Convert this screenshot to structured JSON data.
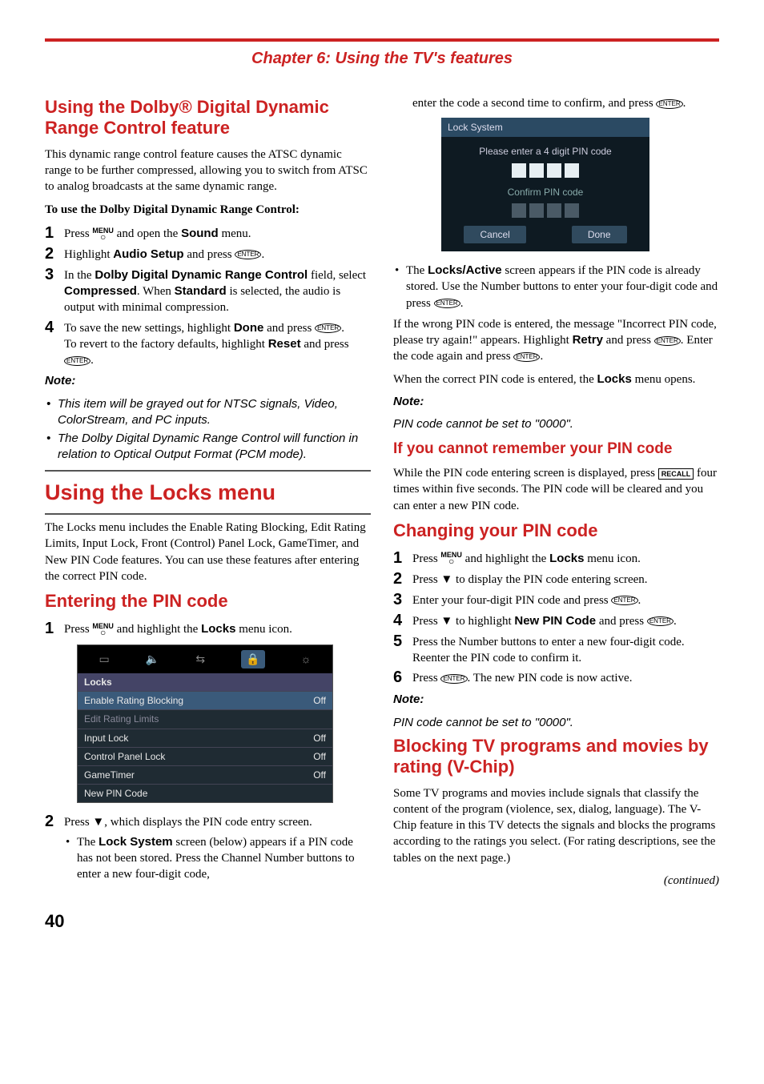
{
  "chapter": "Chapter 6: Using the TV's features",
  "left": {
    "h_dolby": "Using the Dolby® Digital Dynamic Range Control feature",
    "p_dolby_intro": "This dynamic range control feature causes the ATSC dynamic range to be further compressed, allowing you to switch from ATSC to analog broadcasts at the same dynamic range.",
    "p_dolby_use": "To use the Dolby Digital Dynamic Range Control:",
    "s1a": "Press ",
    "s1b": " and open the ",
    "s1c": "Sound",
    "s1d": " menu.",
    "s2a": "Highlight ",
    "s2b": "Audio Setup",
    "s2c": " and press ",
    "s3a": "In the ",
    "s3b": "Dolby Digital Dynamic Range Control",
    "s3c": " field, select ",
    "s3d": "Compressed",
    "s3e": ". When ",
    "s3f": "Standard",
    "s3g": " is selected, the audio is output with minimal compression.",
    "s4a": "To save the new settings, highlight ",
    "s4b": "Done",
    "s4c": " and press ",
    "s4d": "To revert to the factory defaults, highlight ",
    "s4e": "Reset",
    "s4f": " and press ",
    "note": "Note:",
    "note1": "This item will be grayed out for NTSC signals, Video, ColorStream, and PC inputs.",
    "note2": "The Dolby Digital Dynamic Range Control will function in relation to Optical Output Format (PCM mode).",
    "h_locks": "Using the Locks menu",
    "p_locks_intro": "The Locks menu includes the Enable Rating Blocking, Edit Rating Limits, Input Lock, Front (Control) Panel Lock, GameTimer, and New PIN Code features. You can use these features after entering the correct PIN code.",
    "h_enter_pin": "Entering the PIN code",
    "ep1a": "Press ",
    "ep1b": " and highlight the ",
    "ep1c": "Locks",
    "ep1d": " menu icon.",
    "locks_ui": {
      "title": "Locks",
      "rows": [
        {
          "label": "Enable Rating Blocking",
          "val": "Off"
        },
        {
          "label": "Edit Rating Limits",
          "val": ""
        },
        {
          "label": "Input Lock",
          "val": "Off"
        },
        {
          "label": "Control Panel Lock",
          "val": "Off"
        },
        {
          "label": "GameTimer",
          "val": "Off"
        },
        {
          "label": "New PIN Code",
          "val": ""
        }
      ]
    },
    "ep2a": "Press ",
    "ep2b": ", which displays the PIN code entry screen.",
    "ep2_b1a": "The ",
    "ep2_b1b": "Lock System",
    "ep2_b1c": " screen (below) appears if a PIN code has not been stored. Press the Channel Number buttons to enter a new four-digit code,"
  },
  "right": {
    "cont_top": "enter the code a second time to confirm, and press ",
    "locksys": {
      "title": "Lock System",
      "msg1": "Please enter a 4 digit PIN code",
      "msg2": "Confirm PIN code",
      "cancel": "Cancel",
      "done": "Done"
    },
    "b2a": "The ",
    "b2b": "Locks/Active",
    "b2c": " screen appears if the PIN code is already stored. Use the Number buttons to enter your four-digit code and press ",
    "wrong1": "If the wrong PIN code is entered, the message \"Incorrect PIN code, please try again!\" appears. Highlight ",
    "wrong2": "Retry",
    "wrong3": " and press ",
    "wrong4": ". Enter the code again and press ",
    "correct1": "When the correct PIN code is entered, the ",
    "correct2": "Locks",
    "correct3": " menu opens.",
    "note": "Note:",
    "note_pin": "PIN code cannot be set to \"0000\".",
    "h_forget": "If you cannot remember your PIN code",
    "p_forget1": "While the PIN code entering screen is displayed, press ",
    "p_forget2": " four times within five seconds. The PIN code will be cleared and you can enter a new PIN code.",
    "h_change": "Changing your PIN code",
    "c1a": "Press ",
    "c1b": " and highlight the ",
    "c1c": "Locks",
    "c1d": " menu icon.",
    "c2a": "Press ",
    "c2b": " to display the PIN code entering screen.",
    "c3a": "Enter your four-digit PIN code and press ",
    "c4a": "Press ",
    "c4b": " to highlight ",
    "c4c": "New PIN Code",
    "c4d": " and press ",
    "c5": "Press the Number buttons to enter a new four-digit code. Reenter the PIN code to confirm it.",
    "c6a": "Press ",
    "c6b": ". The new PIN code is now active.",
    "h_block": "Blocking TV programs and movies by rating (V-Chip)",
    "p_block": "Some TV programs and movies include signals that classify the content of the program (violence, sex, dialog, language). The V-Chip feature in this TV detects the signals and blocks the programs according to the ratings you select. (For rating descriptions, see the tables on the next page.)",
    "continued": "(continued)"
  },
  "labels": {
    "menu": "MENU",
    "enter": "ENTER",
    "recall": "RECALL",
    "down": "▼"
  },
  "page_num": "40"
}
